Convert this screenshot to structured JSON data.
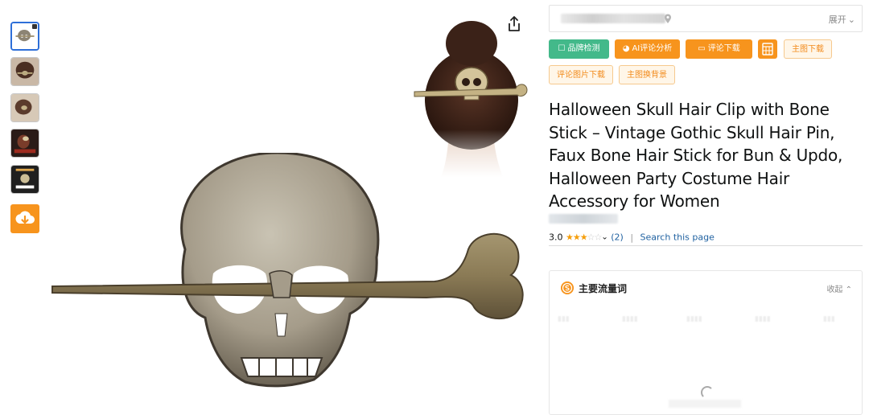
{
  "expand_label": "展开",
  "toolbar": {
    "brand_check": "品牌检测",
    "ai_review": "AI评论分析",
    "review_download": "评论下载",
    "calculator": "calculator-icon",
    "main_image_download": "主图下载",
    "review_image_download": "评论图片下载",
    "main_image_bg": "主图换背景"
  },
  "product": {
    "title": "Halloween Skull Hair Clip with Bone Stick – Vintage Gothic Skull Hair Pin, Faux Bone Hair Stick for Bun & Updo, Halloween Party Costume Hair Accessory for Women",
    "rating_value": "3.0",
    "rating_stars": 3,
    "review_count": "(2)",
    "search_link": "Search this page"
  },
  "traffic_panel": {
    "title": "主要流量词",
    "collapse_label": "收起"
  },
  "colors": {
    "accent_orange": "#f7941d",
    "accent_green": "#43b98a",
    "link_blue": "#2162a1",
    "star": "#f59e0b"
  }
}
